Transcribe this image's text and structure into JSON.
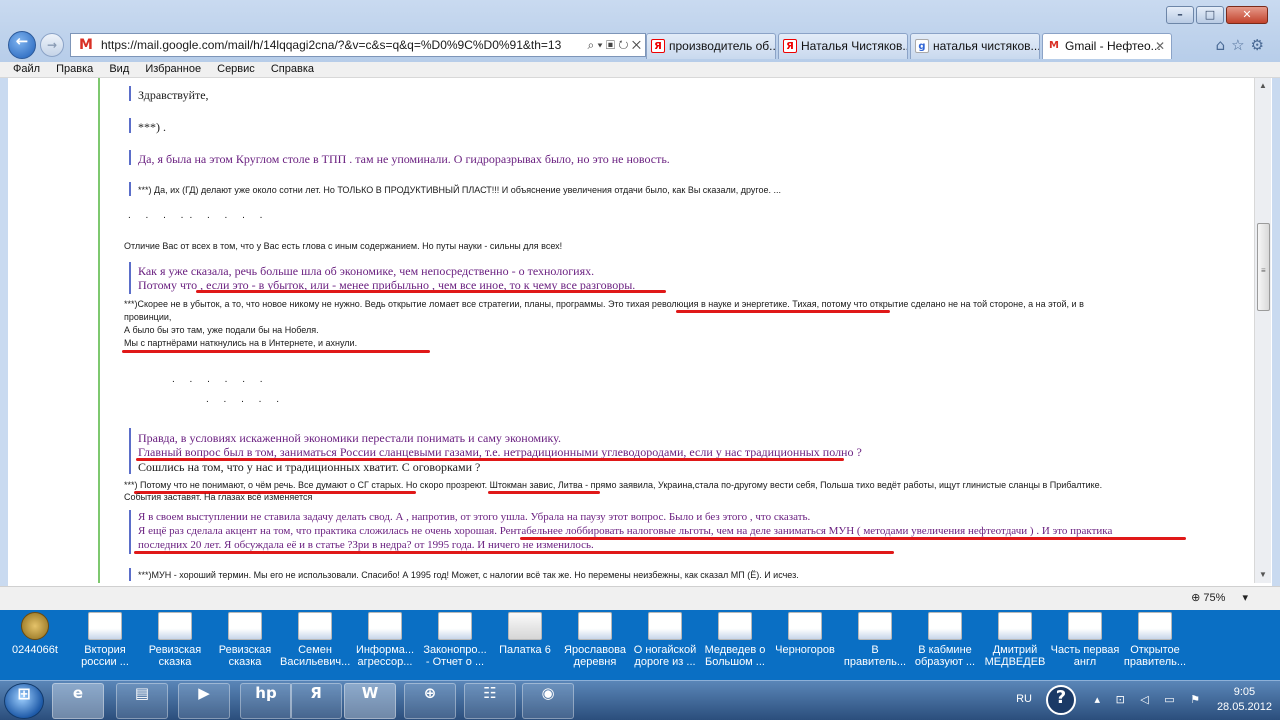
{
  "window": {
    "controls": [
      "–",
      "□",
      "✕"
    ]
  },
  "nav": {
    "back_glyph": "←",
    "forward_glyph": "→",
    "url": "https://mail.google.com/mail/h/14lqqagi2cna/?&v=c&s=q&q=%D0%9C%D0%91&th=13",
    "url_icons": "⌕ ▾ ▣ ↻ ✕"
  },
  "tabs": [
    {
      "label": "производитель об...",
      "favicon": "Я"
    },
    {
      "label": "Наталья Чистяков...",
      "favicon": "Я"
    },
    {
      "label": "наталья чистяков...",
      "favicon": "g"
    },
    {
      "label": "Gmail - Нефтео...",
      "favicon": "M",
      "close": "✕"
    }
  ],
  "chrome_icons": "⌂☆⚙",
  "menu": [
    "Файл",
    "Правка",
    "Вид",
    "Избранное",
    "Сервис",
    "Справка"
  ],
  "email": {
    "greeting": "Здравствуйте,",
    "q1": "***) .",
    "p1": "Да,   я  была    на  этом Круглом  столе  в ТПП .                 там не упоминали.   О гидроразрывах было, но это не  новость.",
    "r1": "***) Да, их (ГД) делают уже около сотни лет. Но ТОЛЬКО В ПРОДУКТИВНЫЙ ПЛАСТ!!! И объяснение увеличения отдачи было, как Вы сказали, другое. ...",
    "r2": "Отличие Вас от всех в том, что у Вас есть глова с иным содержанием. Но путы науки - сильны для всех!",
    "p2a": "Как  я  уже сказала,  речь   больше  шла об экономике, чем непосредственно -  о технологиях.",
    "p2b": "Потому что    ,  если  это -  в убыток,   или -     менее прибыльно , чем все иное, то   к чему  все разговоры.",
    "r3a": "***)Скорее не в убыток, а то, что новое никому не нужно. Ведь открытие      ломает все стратегии, планы, программы. Это тихая революция в науке и  энергетике. Тихая, потому что открытие сделано не на той стороне, а на этой, и в",
    "r3b": "провинции,",
    "r3c": "А было бы это там, уже подали бы на Нобеля.",
    "r3d": "Мы с партнёрами наткнулись на        в Интернете, и ахнули.",
    "p3a": "Правда,  в условиях искаженной  экономики  перестали     понимать и саму     экономику.",
    "p3b": "Главный  вопрос  был в том,  заниматься России   сланцевыми  газами, т.е. нетрадиционными углеводородами,  если у нас  традиционных полно     ?",
    "p3c": "Сошлись на том, что  у нас и традиционных   хватит.  С оговорками ?",
    "r4a": "***) Потому что не понимают, о чём речь. Все думают о СГ старых. Но скоро прозреют. Штокман завис, Литва - прямо заявила, Украина,стала по-другому вести себя, Польша тихо ведёт работы, ищут глинистые сланцы в Прибалтике.",
    "r4b": "События заставят. На глазах всё изменяется",
    "p4a": "Я  в своем выступлении не ставила  задачу   делать свод.     А , напротив,   от  этого  ушла.     Убрала на паузу этот  вопрос. Было и без  этого ,   что сказать.",
    "p4b": "Я  ещё  раз сделала  акцент на том, что  практика  сложилась не очень  хорошая.  Рентабельнее   лоббировать  налоговые льготы, чем  на деле   заниматься МУН ( методами увеличения  нефтеотдачи ) . И это практика",
    "p4c": "последних  20 лет. Я  обсуждала её и в  статье ?Зри в недра? от 1995 года. И ничего  не изменилось.",
    "r5": "***)МУН - хороший термин. Мы его не использовали. Спасибо! А 1995 год!  Может, с налогии всё так же. Но перемены неизбежны, как сказал МП (Ё). И исчез."
  },
  "status": {
    "zoom": "75%",
    "zoom_icon": "zoom-icon"
  },
  "desktop_icons": [
    "0244066t",
    "Вктория россии ...",
    "Ревизская сказка",
    "Ревизская сказка",
    "Семен Васильевич...",
    "Информа... агрессор...",
    "Законопро... - Отчет о ...",
    "Палатка 6",
    "Ярославова деревня",
    "О ногайской дороге из ...",
    "Медведев о Большом ...",
    "Черногоров",
    "В правитель...",
    "В кабмине образуют ...",
    "Дмитрий МЕДВЕДЕВ",
    "Часть первая англ",
    "Открытое правитель..."
  ],
  "taskbar": {
    "start_glyph": "⊞",
    "apps": [
      "e",
      "▤",
      "▶",
      "hp",
      "Я",
      "W",
      "⊕",
      "☷",
      "◉"
    ],
    "lang": "RU",
    "help": "?",
    "tray_icons": "▴ ⊡ ◁ ▭ ⚑",
    "time": "9:05",
    "date": "28.05.2012"
  }
}
